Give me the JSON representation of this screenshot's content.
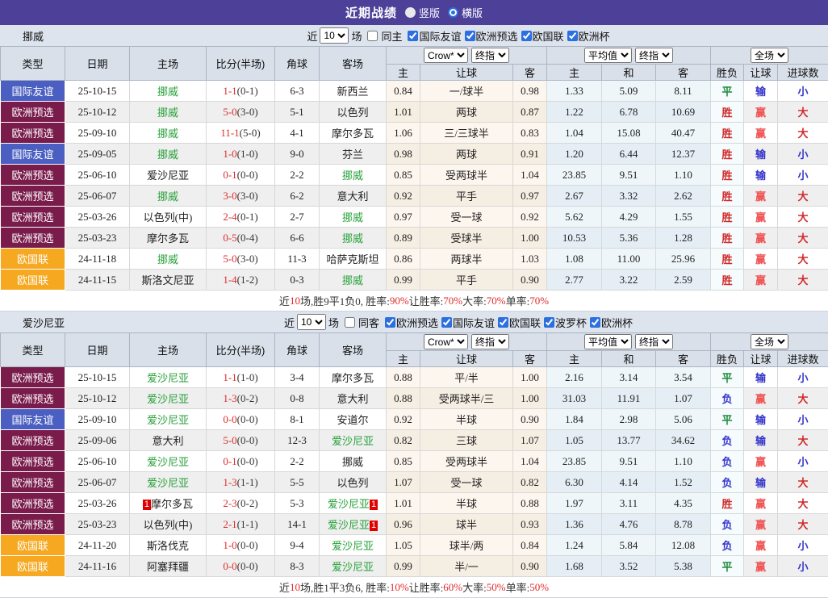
{
  "titlebar": {
    "title": "近期战绩",
    "view_options": [
      {
        "label": "竖版",
        "selected": false
      },
      {
        "label": "横版",
        "selected": true
      }
    ]
  },
  "colors": {
    "topbar_purple": "#4c4098",
    "type_friendly_blue": "#4a5fc1",
    "type_qualifier_maroon": "#791b4b",
    "type_nations_orange": "#f6a821",
    "team_highlight_green": "#2aa23c",
    "score_red": "#e02b2b",
    "result_red": "#d02a2a",
    "result_green": "#1e8c3c",
    "result_blue": "#3333cc"
  },
  "table_header": {
    "main_cols": [
      "类型",
      "日期",
      "主场",
      "比分(半场)",
      "角球",
      "客场"
    ],
    "group_selects": [
      "Crow*",
      "终指",
      "平均值",
      "终指",
      "全场"
    ],
    "sub_cols": [
      "主",
      "让球",
      "客",
      "主",
      "和",
      "客",
      "胜负",
      "让球",
      "进球数"
    ]
  },
  "sections": [
    {
      "team": "挪威",
      "filter": {
        "prefix": "近",
        "count": "10",
        "suffix": "场",
        "same": {
          "label": "同主",
          "checked": false
        },
        "leagues": [
          {
            "label": "国际友谊",
            "checked": true
          },
          {
            "label": "欧洲预选",
            "checked": true
          },
          {
            "label": "欧国联",
            "checked": true
          },
          {
            "label": "欧洲杯",
            "checked": true
          }
        ]
      },
      "rows": [
        {
          "type": "国际友谊",
          "tk": "friendly",
          "date": "25-10-15",
          "home": "挪威",
          "hhl": true,
          "hcard": "",
          "score": "1-1",
          "half": "(0-1)",
          "corner": "6-3",
          "away": "新西兰",
          "ahl": false,
          "acard": "",
          "ch": "0.84",
          "hc": "一/球半",
          "ca": "0.98",
          "ah": "1.33",
          "ad": "5.09",
          "aa": "8.11",
          "r1": "平",
          "r2": "输",
          "r3": "小"
        },
        {
          "type": "欧洲预选",
          "tk": "qual",
          "date": "25-10-12",
          "home": "挪威",
          "hhl": true,
          "hcard": "",
          "score": "5-0",
          "half": "(3-0)",
          "corner": "5-1",
          "away": "以色列",
          "ahl": false,
          "acard": "",
          "ch": "1.01",
          "hc": "两球",
          "ca": "0.87",
          "ah": "1.22",
          "ad": "6.78",
          "aa": "10.69",
          "r1": "胜",
          "r2": "赢",
          "r3": "大"
        },
        {
          "type": "欧洲预选",
          "tk": "qual",
          "date": "25-09-10",
          "home": "挪威",
          "hhl": true,
          "hcard": "",
          "score": "11-1",
          "half": "(5-0)",
          "corner": "4-1",
          "away": "摩尔多瓦",
          "ahl": false,
          "acard": "",
          "ch": "1.06",
          "hc": "三/三球半",
          "ca": "0.83",
          "ah": "1.04",
          "ad": "15.08",
          "aa": "40.47",
          "r1": "胜",
          "r2": "赢",
          "r3": "大"
        },
        {
          "type": "国际友谊",
          "tk": "friendly",
          "date": "25-09-05",
          "home": "挪威",
          "hhl": true,
          "hcard": "",
          "score": "1-0",
          "half": "(1-0)",
          "corner": "9-0",
          "away": "芬兰",
          "ahl": false,
          "acard": "",
          "ch": "0.98",
          "hc": "两球",
          "ca": "0.91",
          "ah": "1.20",
          "ad": "6.44",
          "aa": "12.37",
          "r1": "胜",
          "r2": "输",
          "r3": "小"
        },
        {
          "type": "欧洲预选",
          "tk": "qual",
          "date": "25-06-10",
          "home": "爱沙尼亚",
          "hhl": false,
          "hcard": "",
          "score": "0-1",
          "half": "(0-0)",
          "corner": "2-2",
          "away": "挪威",
          "ahl": true,
          "acard": "",
          "ch": "0.85",
          "hc": "受两球半",
          "ca": "1.04",
          "ah": "23.85",
          "ad": "9.51",
          "aa": "1.10",
          "r1": "胜",
          "r2": "输",
          "r3": "小"
        },
        {
          "type": "欧洲预选",
          "tk": "qual",
          "date": "25-06-07",
          "home": "挪威",
          "hhl": true,
          "hcard": "",
          "score": "3-0",
          "half": "(3-0)",
          "corner": "6-2",
          "away": "意大利",
          "ahl": false,
          "acard": "",
          "ch": "0.92",
          "hc": "平手",
          "ca": "0.97",
          "ah": "2.67",
          "ad": "3.32",
          "aa": "2.62",
          "r1": "胜",
          "r2": "赢",
          "r3": "大"
        },
        {
          "type": "欧洲预选",
          "tk": "qual",
          "date": "25-03-26",
          "home": "以色列(中)",
          "hhl": false,
          "hcard": "",
          "score": "2-4",
          "half": "(0-1)",
          "corner": "2-7",
          "away": "挪威",
          "ahl": true,
          "acard": "",
          "ch": "0.97",
          "hc": "受一球",
          "ca": "0.92",
          "ah": "5.62",
          "ad": "4.29",
          "aa": "1.55",
          "r1": "胜",
          "r2": "赢",
          "r3": "大"
        },
        {
          "type": "欧洲预选",
          "tk": "qual",
          "date": "25-03-23",
          "home": "摩尔多瓦",
          "hhl": false,
          "hcard": "",
          "score": "0-5",
          "half": "(0-4)",
          "corner": "6-6",
          "away": "挪威",
          "ahl": true,
          "acard": "",
          "ch": "0.89",
          "hc": "受球半",
          "ca": "1.00",
          "ah": "10.53",
          "ad": "5.36",
          "aa": "1.28",
          "r1": "胜",
          "r2": "赢",
          "r3": "大"
        },
        {
          "type": "欧国联",
          "tk": "nations",
          "date": "24-11-18",
          "home": "挪威",
          "hhl": true,
          "hcard": "",
          "score": "5-0",
          "half": "(3-0)",
          "corner": "11-3",
          "away": "哈萨克斯坦",
          "ahl": false,
          "acard": "",
          "ch": "0.86",
          "hc": "两球半",
          "ca": "1.03",
          "ah": "1.08",
          "ad": "11.00",
          "aa": "25.96",
          "r1": "胜",
          "r2": "赢",
          "r3": "大"
        },
        {
          "type": "欧国联",
          "tk": "nations",
          "date": "24-11-15",
          "home": "斯洛文尼亚",
          "hhl": false,
          "hcard": "",
          "score": "1-4",
          "half": "(1-2)",
          "corner": "0-3",
          "away": "挪威",
          "ahl": true,
          "acard": "",
          "ch": "0.99",
          "hc": "平手",
          "ca": "0.90",
          "ah": "2.77",
          "ad": "3.22",
          "aa": "2.59",
          "r1": "胜",
          "r2": "赢",
          "r3": "大"
        }
      ],
      "summary": [
        {
          "t": "近",
          "r": false
        },
        {
          "t": "10",
          "r": true
        },
        {
          "t": "场,胜9平1负0, 胜率:",
          "r": false
        },
        {
          "t": "90%",
          "r": true
        },
        {
          "t": " 让胜率:",
          "r": false
        },
        {
          "t": "70%",
          "r": true
        },
        {
          "t": " 大率:",
          "r": false
        },
        {
          "t": "70%",
          "r": true
        },
        {
          "t": " 单率:",
          "r": false
        },
        {
          "t": "70%",
          "r": true
        }
      ]
    },
    {
      "team": "爱沙尼亚",
      "filter": {
        "prefix": "近",
        "count": "10",
        "suffix": "场",
        "same": {
          "label": "同客",
          "checked": false
        },
        "leagues": [
          {
            "label": "欧洲预选",
            "checked": true
          },
          {
            "label": "国际友谊",
            "checked": true
          },
          {
            "label": "欧国联",
            "checked": true
          },
          {
            "label": "波罗杯",
            "checked": true
          },
          {
            "label": "欧洲杯",
            "checked": true
          }
        ]
      },
      "rows": [
        {
          "type": "欧洲预选",
          "tk": "qual",
          "date": "25-10-15",
          "home": "爱沙尼亚",
          "hhl": true,
          "hcard": "",
          "score": "1-1",
          "half": "(1-0)",
          "corner": "3-4",
          "away": "摩尔多瓦",
          "ahl": false,
          "acard": "",
          "ch": "0.88",
          "hc": "平/半",
          "ca": "1.00",
          "ah": "2.16",
          "ad": "3.14",
          "aa": "3.54",
          "r1": "平",
          "r2": "输",
          "r3": "小"
        },
        {
          "type": "欧洲预选",
          "tk": "qual",
          "date": "25-10-12",
          "home": "爱沙尼亚",
          "hhl": true,
          "hcard": "",
          "score": "1-3",
          "half": "(0-2)",
          "corner": "0-8",
          "away": "意大利",
          "ahl": false,
          "acard": "",
          "ch": "0.88",
          "hc": "受两球半/三",
          "ca": "1.00",
          "ah": "31.03",
          "ad": "11.91",
          "aa": "1.07",
          "r1": "负",
          "r2": "赢",
          "r3": "大"
        },
        {
          "type": "国际友谊",
          "tk": "friendly",
          "date": "25-09-10",
          "home": "爱沙尼亚",
          "hhl": true,
          "hcard": "",
          "score": "0-0",
          "half": "(0-0)",
          "corner": "8-1",
          "away": "安道尔",
          "ahl": false,
          "acard": "",
          "ch": "0.92",
          "hc": "半球",
          "ca": "0.90",
          "ah": "1.84",
          "ad": "2.98",
          "aa": "5.06",
          "r1": "平",
          "r2": "输",
          "r3": "小"
        },
        {
          "type": "欧洲预选",
          "tk": "qual",
          "date": "25-09-06",
          "home": "意大利",
          "hhl": false,
          "hcard": "",
          "score": "5-0",
          "half": "(0-0)",
          "corner": "12-3",
          "away": "爱沙尼亚",
          "ahl": true,
          "acard": "",
          "ch": "0.82",
          "hc": "三球",
          "ca": "1.07",
          "ah": "1.05",
          "ad": "13.77",
          "aa": "34.62",
          "r1": "负",
          "r2": "输",
          "r3": "大"
        },
        {
          "type": "欧洲预选",
          "tk": "qual",
          "date": "25-06-10",
          "home": "爱沙尼亚",
          "hhl": true,
          "hcard": "",
          "score": "0-1",
          "half": "(0-0)",
          "corner": "2-2",
          "away": "挪威",
          "ahl": false,
          "acard": "",
          "ch": "0.85",
          "hc": "受两球半",
          "ca": "1.04",
          "ah": "23.85",
          "ad": "9.51",
          "aa": "1.10",
          "r1": "负",
          "r2": "赢",
          "r3": "小"
        },
        {
          "type": "欧洲预选",
          "tk": "qual",
          "date": "25-06-07",
          "home": "爱沙尼亚",
          "hhl": true,
          "hcard": "",
          "score": "1-3",
          "half": "(1-1)",
          "corner": "5-5",
          "away": "以色列",
          "ahl": false,
          "acard": "",
          "ch": "1.07",
          "hc": "受一球",
          "ca": "0.82",
          "ah": "6.30",
          "ad": "4.14",
          "aa": "1.52",
          "r1": "负",
          "r2": "输",
          "r3": "大"
        },
        {
          "type": "欧洲预选",
          "tk": "qual",
          "date": "25-03-26",
          "home": "摩尔多瓦",
          "hhl": false,
          "hcard": "1",
          "score": "2-3",
          "half": "(0-2)",
          "corner": "5-3",
          "away": "爱沙尼亚",
          "ahl": true,
          "acard": "1",
          "ch": "1.01",
          "hc": "半球",
          "ca": "0.88",
          "ah": "1.97",
          "ad": "3.11",
          "aa": "4.35",
          "r1": "胜",
          "r2": "赢",
          "r3": "大"
        },
        {
          "type": "欧洲预选",
          "tk": "qual",
          "date": "25-03-23",
          "home": "以色列(中)",
          "hhl": false,
          "hcard": "",
          "score": "2-1",
          "half": "(1-1)",
          "corner": "14-1",
          "away": "爱沙尼亚",
          "ahl": true,
          "acard": "1",
          "ch": "0.96",
          "hc": "球半",
          "ca": "0.93",
          "ah": "1.36",
          "ad": "4.76",
          "aa": "8.78",
          "r1": "负",
          "r2": "赢",
          "r3": "大"
        },
        {
          "type": "欧国联",
          "tk": "nations",
          "date": "24-11-20",
          "home": "斯洛伐克",
          "hhl": false,
          "hcard": "",
          "score": "1-0",
          "half": "(0-0)",
          "corner": "9-4",
          "away": "爱沙尼亚",
          "ahl": true,
          "acard": "",
          "ch": "1.05",
          "hc": "球半/两",
          "ca": "0.84",
          "ah": "1.24",
          "ad": "5.84",
          "aa": "12.08",
          "r1": "负",
          "r2": "赢",
          "r3": "小"
        },
        {
          "type": "欧国联",
          "tk": "nations",
          "date": "24-11-16",
          "home": "阿塞拜疆",
          "hhl": false,
          "hcard": "",
          "score": "0-0",
          "half": "(0-0)",
          "corner": "8-3",
          "away": "爱沙尼亚",
          "ahl": true,
          "acard": "",
          "ch": "0.99",
          "hc": "半/一",
          "ca": "0.90",
          "ah": "1.68",
          "ad": "3.52",
          "aa": "5.38",
          "r1": "平",
          "r2": "赢",
          "r3": "小"
        }
      ],
      "summary": [
        {
          "t": "近",
          "r": false
        },
        {
          "t": "10",
          "r": true
        },
        {
          "t": "场,胜1平3负6, 胜率:",
          "r": false
        },
        {
          "t": "10%",
          "r": true
        },
        {
          "t": " 让胜率:",
          "r": false
        },
        {
          "t": "60%",
          "r": true
        },
        {
          "t": " 大率:",
          "r": false
        },
        {
          "t": "50%",
          "r": true
        },
        {
          "t": " 单率:",
          "r": false
        },
        {
          "t": "50%",
          "r": true
        }
      ]
    }
  ]
}
